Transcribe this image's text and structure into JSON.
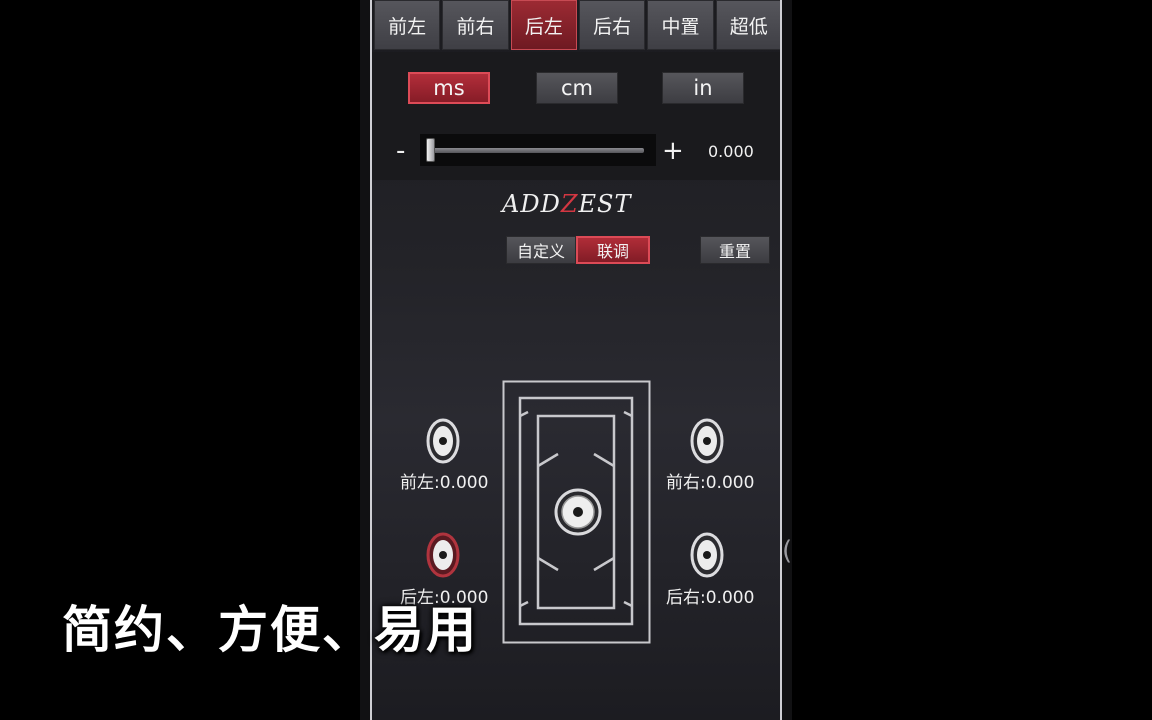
{
  "tabs": [
    {
      "label": "前左",
      "active": false
    },
    {
      "label": "前右",
      "active": false
    },
    {
      "label": "后左",
      "active": true
    },
    {
      "label": "后右",
      "active": false
    },
    {
      "label": "中置",
      "active": false
    },
    {
      "label": "超低",
      "active": false
    }
  ],
  "units": {
    "selected": "ms",
    "ms": "ms",
    "cm": "cm",
    "in": "in"
  },
  "slider": {
    "minus": "-",
    "plus": "+",
    "value": "0.000",
    "fraction": 0
  },
  "brand": {
    "text": "ADDZEST"
  },
  "modes": {
    "custom": "自定义",
    "linked": "联调",
    "reset": "重置",
    "selected": "联调"
  },
  "speakers": {
    "front_left": "前左:0.000",
    "front_right": "前右:0.000",
    "rear_left": "后左:0.000",
    "rear_right": "后右:0.000",
    "selected": "rear_left"
  },
  "caption": "简约、方便、易用",
  "colors": {
    "accent": "#9c2a33",
    "accent_border": "#d94a55",
    "background": "#1b1b1f"
  },
  "icons": [
    "speaker-icon",
    "car-outline-icon",
    "subwoofer-icon",
    "slider-thumb-icon"
  ]
}
